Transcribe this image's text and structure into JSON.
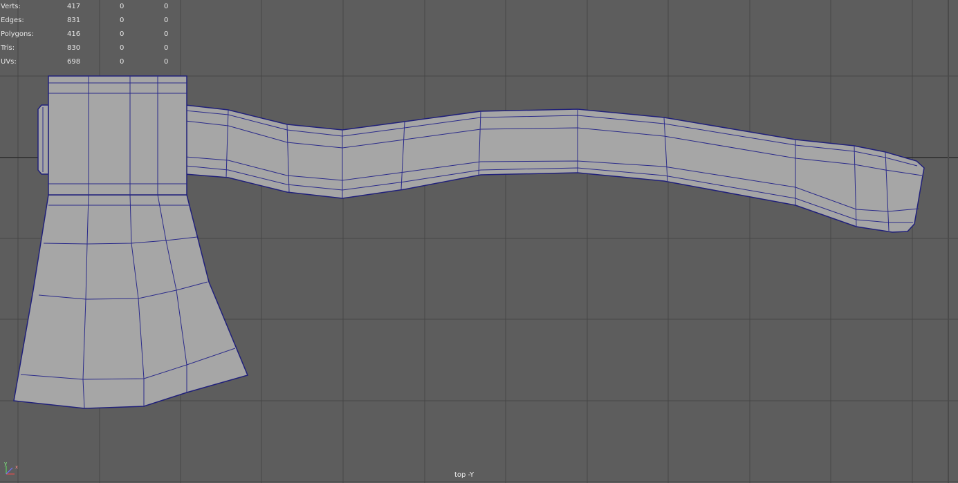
{
  "viewport": {
    "camera_label": "top -Y",
    "background": "#5d5d5d",
    "grid_color": "#464646",
    "mesh_fill": "#a6a6a6",
    "wire_color": "#20207a"
  },
  "hud": {
    "rows": [
      {
        "label": "Verts:",
        "total": "417",
        "selected": "0",
        "components": "0"
      },
      {
        "label": "Edges:",
        "total": "831",
        "selected": "0",
        "components": "0"
      },
      {
        "label": "Polygons:",
        "total": "416",
        "selected": "0",
        "components": "0"
      },
      {
        "label": "Tris:",
        "total": "830",
        "selected": "0",
        "components": "0"
      },
      {
        "label": "UVs:",
        "total": "698",
        "selected": "0",
        "components": "0"
      }
    ]
  },
  "axis_gizmo": {
    "x_label": "x",
    "y_label": "y"
  }
}
